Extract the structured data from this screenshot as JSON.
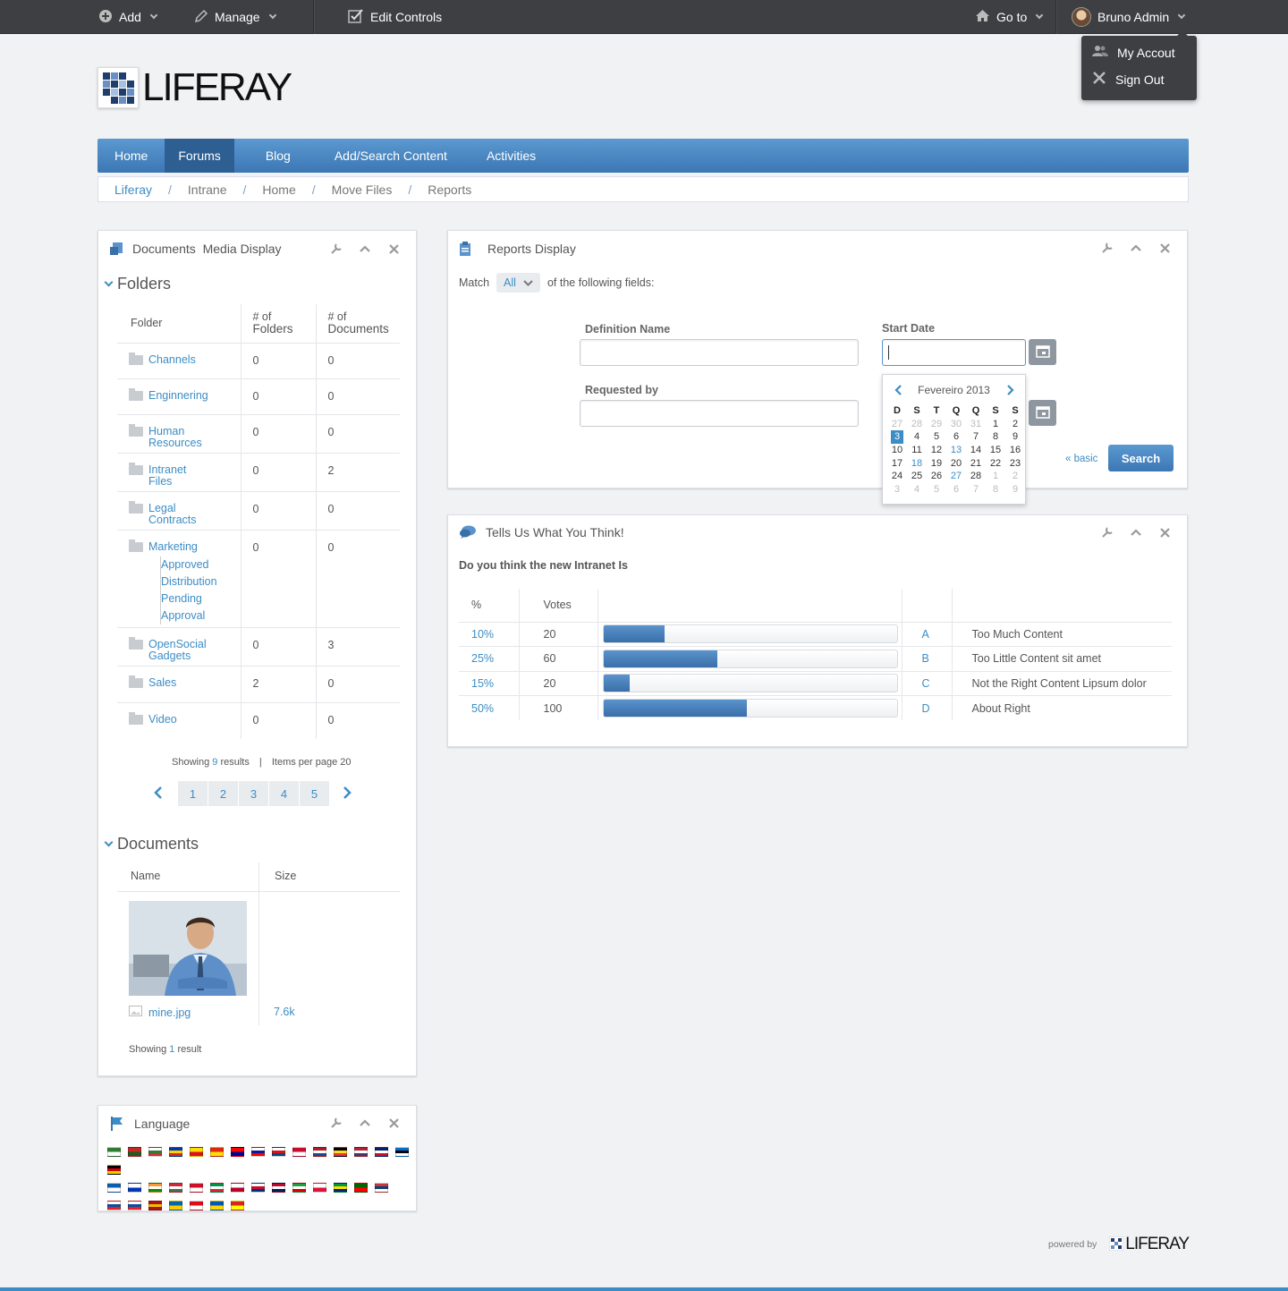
{
  "dockbar": {
    "add_label": "Add",
    "manage_label": "Manage",
    "edit_controls_label": "Edit Controls",
    "goto_label": "Go to",
    "user_name": "Bruno Admin"
  },
  "user_menu": {
    "my_account": "My Accout",
    "sign_out": "Sign Out"
  },
  "logo": {
    "text": "LIFERAY"
  },
  "nav": {
    "items": [
      {
        "label": "Home"
      },
      {
        "label": "Forums"
      },
      {
        "label": "Blog"
      },
      {
        "label": "Add/Search Content"
      },
      {
        "label": "Activities"
      }
    ]
  },
  "breadcrumb": {
    "items": [
      {
        "label": "Liferay"
      },
      {
        "label": "Intrane"
      },
      {
        "label": "Home"
      },
      {
        "label": "Move Files"
      },
      {
        "label": "Reports"
      }
    ],
    "separator": "/"
  },
  "docs_portlet": {
    "title": "Documents  Media Display",
    "folders_heading": "Folders",
    "columns": [
      "Folder",
      "# of\nFolders",
      "# of\nDocuments"
    ],
    "col_folder": "Folder",
    "col_folders_a": "# of",
    "col_folders_b": "Folders",
    "col_docs_a": "# of",
    "col_docs_b": "Documents",
    "rows": [
      {
        "name": "Channels",
        "folders": "0",
        "docs": "0"
      },
      {
        "name": "Enginnering",
        "folders": "0",
        "docs": "0"
      },
      {
        "name": "Human Resources",
        "folders": "0",
        "docs": "0"
      },
      {
        "name": "Intranet Files",
        "folders": "0",
        "docs": "2"
      },
      {
        "name": "Legal Contracts",
        "folders": "0",
        "docs": "0"
      },
      {
        "name": "Marketing",
        "folders": "0",
        "docs": "0",
        "sub": "Approved Distribution Pending Approval"
      },
      {
        "name": "OpenSocial Gadgets",
        "folders": "0",
        "docs": "3"
      },
      {
        "name": "Sales",
        "folders": "2",
        "docs": "0"
      },
      {
        "name": "Video",
        "folders": "0",
        "docs": "0"
      }
    ],
    "showing_prefix": "Showing",
    "showing_count": "9",
    "showing_suffix": "results",
    "items_per_page": "Items per page 20",
    "pages": [
      "1",
      "2",
      "3",
      "4",
      "5"
    ],
    "documents_heading": "Documents",
    "doc_col_name": "Name",
    "doc_col_size": "Size",
    "doc_file": "mine.jpg",
    "doc_size": "7.6k",
    "doc_showing_prefix": "Showing",
    "doc_showing_count": "1",
    "doc_showing_suffix": "result"
  },
  "language_portlet": {
    "title": "Language"
  },
  "reports_portlet": {
    "title": "Reports Display",
    "match_prefix": "Match",
    "match_value": "All",
    "match_suffix": "of the following fields:",
    "definition_name_label": "Definition Name",
    "start_date_label": "Start Date",
    "requested_by_label": "Requested by",
    "basic_link": "« basic",
    "search_button": "Search"
  },
  "calendar": {
    "month": "Fevereiro 2013",
    "weekdays": [
      "D",
      "S",
      "T",
      "Q",
      "Q",
      "S",
      "S"
    ],
    "weeks": [
      [
        "27",
        "28",
        "29",
        "30",
        "31",
        "1",
        "2"
      ],
      [
        "3",
        "4",
        "5",
        "6",
        "7",
        "8",
        "9"
      ],
      [
        "10",
        "11",
        "12",
        "13",
        "14",
        "15",
        "16"
      ],
      [
        "17",
        "18",
        "19",
        "20",
        "21",
        "22",
        "23"
      ],
      [
        "24",
        "25",
        "26",
        "27",
        "28",
        "1",
        "2"
      ],
      [
        "3",
        "4",
        "5",
        "6",
        "7",
        "8",
        "9"
      ]
    ]
  },
  "poll_portlet": {
    "title": "Tells Us What You Think!",
    "question": "Do you think the new Intranet Is",
    "col_percent": "%",
    "col_votes": "Votes",
    "rows": [
      {
        "percent": "10%",
        "votes": "20",
        "fill": 0.21,
        "letter": "A",
        "answer": "Too Much Content"
      },
      {
        "percent": "25%",
        "votes": "60",
        "fill": 0.39,
        "letter": "B",
        "answer": "Too Little Content sit amet"
      },
      {
        "percent": "15%",
        "votes": "20",
        "fill": 0.09,
        "letter": "C",
        "answer": "Not the Right Content Lipsum dolor"
      },
      {
        "percent": "50%",
        "votes": "100",
        "fill": 0.49,
        "letter": "D",
        "answer": "About Right"
      }
    ]
  },
  "footer": {
    "powered_by": "powered by",
    "logo_text": "LIFERAY"
  },
  "colors": {
    "accent": "#3c8dc5",
    "nav_top": "#5b99d0",
    "nav_bottom": "#3c77b4",
    "dockbar": "#3d3f43"
  }
}
